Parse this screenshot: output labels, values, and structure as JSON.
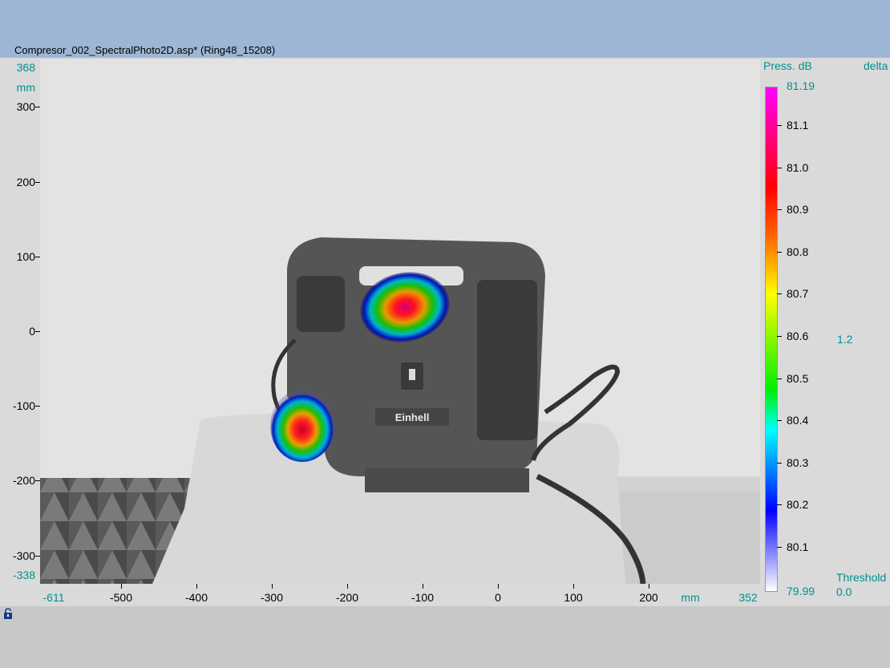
{
  "window": {
    "title": "Compresor_002_SpectralPhoto2D.asp* (Ring48_15208)"
  },
  "plot": {
    "y_axis": {
      "unit": "mm",
      "max": "368",
      "min": "-338",
      "ticks": [
        {
          "label": "300",
          "value": 300
        },
        {
          "label": "200",
          "value": 200
        },
        {
          "label": "100",
          "value": 100
        },
        {
          "label": "0",
          "value": 0
        },
        {
          "label": "-100",
          "value": -100
        },
        {
          "label": "-200",
          "value": -200
        },
        {
          "label": "-300",
          "value": -300
        }
      ]
    },
    "x_axis": {
      "unit": "mm",
      "min": "-611",
      "max": "352",
      "ticks": [
        {
          "label": "-500",
          "value": -500
        },
        {
          "label": "-400",
          "value": -400
        },
        {
          "label": "-300",
          "value": -300
        },
        {
          "label": "-200",
          "value": -200
        },
        {
          "label": "-100",
          "value": -100
        },
        {
          "label": "0",
          "value": 0
        },
        {
          "label": "100",
          "value": 100
        },
        {
          "label": "200",
          "value": 200
        }
      ]
    },
    "device_brand": "Einhell"
  },
  "colorbar": {
    "title": "Press. dB",
    "max": "81.19",
    "min": "79.99",
    "labels": [
      "81.1",
      "81.0",
      "80.9",
      "80.8",
      "80.7",
      "80.6",
      "80.5",
      "80.4",
      "80.3",
      "80.2",
      "80.1"
    ]
  },
  "side": {
    "delta_label": "delta",
    "delta_value": "1.2",
    "threshold_label": "Threshold",
    "threshold_value": "0.0"
  },
  "colors": {
    "accent": "#00908f",
    "titlebar": "#9db6d5"
  },
  "icons": {
    "status": "lock-icon"
  }
}
